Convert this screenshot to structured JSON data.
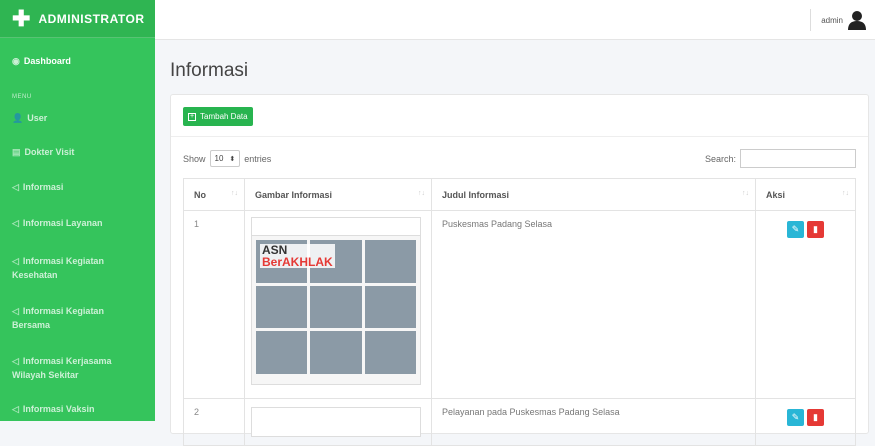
{
  "brand": {
    "title": "ADMINISTRATOR"
  },
  "sidebar": {
    "dashboard": "Dashboard",
    "menu_label": "MENU",
    "items": [
      {
        "label": "User"
      },
      {
        "label": "Dokter Visit"
      },
      {
        "label": "Informasi"
      },
      {
        "label": "Informasi Layanan"
      },
      {
        "label": "Informasi Kegiatan Kesehatan"
      },
      {
        "label": "Informasi Kegiatan Bersama"
      },
      {
        "label": "Informasi Kerjasama Wilayah Sekitar"
      },
      {
        "label": "Informasi Vaksin"
      }
    ]
  },
  "topbar": {
    "username": "admin"
  },
  "page": {
    "title": "Informasi"
  },
  "card": {
    "add_button": "Tambah Data",
    "show_label": "Show",
    "entries_value": "10",
    "entries_label": "entries",
    "search_label": "Search:",
    "columns": [
      "No",
      "Gambar Informasi",
      "Judul Informasi",
      "Aksi"
    ],
    "rows": [
      {
        "no": "1",
        "judul": "Puskesmas Padang Selasa",
        "img_text_1": "ASN",
        "img_text_2": "BerAKHLAK"
      },
      {
        "no": "2",
        "judul": "Pelayanan pada Puskesmas Padang Selasa"
      }
    ]
  },
  "colors": {
    "sidebar": "#35c45c",
    "accent": "#28b44f",
    "edit": "#29b6d6",
    "delete": "#e53935"
  }
}
